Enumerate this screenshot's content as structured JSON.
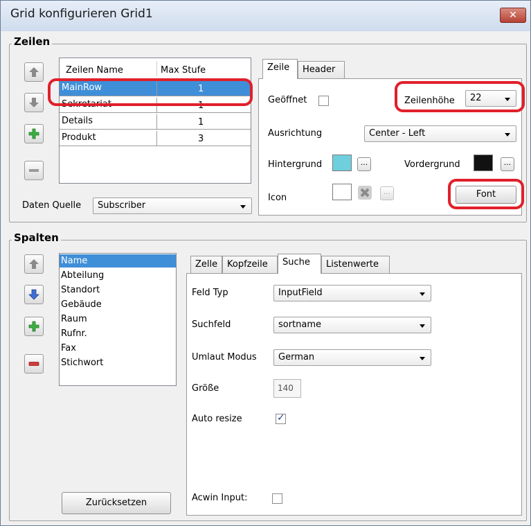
{
  "window": {
    "title": "Grid konfigurieren Grid1",
    "close_label": "✕"
  },
  "rows_group": {
    "title": "Zeilen",
    "columns": [
      "Zeilen Name",
      "Max Stufe"
    ],
    "rows": [
      {
        "name": "MainRow",
        "level": "1",
        "selected": true
      },
      {
        "name": "Sekretariat",
        "level": "1",
        "selected": false
      },
      {
        "name": "Details",
        "level": "1",
        "selected": false
      },
      {
        "name": "Produkt",
        "level": "3",
        "selected": false
      }
    ],
    "datasource_label": "Daten Quelle",
    "datasource_value": "Subscriber",
    "tabs": [
      "Zeile",
      "Header"
    ],
    "active_tab": "Zeile",
    "opened_label": "Geöffnet",
    "row_height_label": "Zeilenhöhe",
    "row_height_value": "22",
    "alignment_label": "Ausrichtung",
    "alignment_value": "Center - Left",
    "background_label": "Hintergrund",
    "background_color": "#6fcfdc",
    "foreground_label": "Vordergrund",
    "foreground_color": "#111111",
    "icon_label": "Icon",
    "font_button": "Font",
    "dots": "..."
  },
  "columns_group": {
    "title": "Spalten",
    "items": [
      "Name",
      "Abteilung",
      "Standort",
      "Gebäude",
      "Raum",
      "Rufnr.",
      "Fax",
      "Stichwort"
    ],
    "selected_index": 0,
    "reset_button": "Zurücksetzen",
    "tabs": [
      "Zelle",
      "Kopfzeile",
      "Suche",
      "Listenwerte"
    ],
    "active_tab": "Suche",
    "field_type_label": "Feld Typ",
    "field_type_value": "InputField",
    "search_field_label": "Suchfeld",
    "search_field_value": "sortname",
    "umlaut_label": "Umlaut Modus",
    "umlaut_value": "German",
    "size_label": "Größe",
    "size_value": "140",
    "auto_resize_label": "Auto resize",
    "auto_resize_checked": true,
    "acwin_label": "Acwin Input:",
    "acwin_checked": false
  },
  "colors": {
    "selection": "#3f8fd8",
    "highlight_ring": "#e0202a",
    "green_plus": "#3cb043",
    "red_minus": "#d23b3b"
  }
}
